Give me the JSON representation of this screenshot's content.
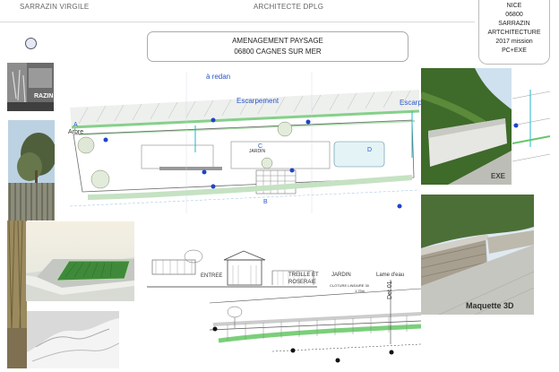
{
  "header": {
    "left": "SARRAZIN VIRGILE",
    "center": "ARCHITECTE DPLG"
  },
  "stamp": {
    "lines": [
      "NICE",
      "06800",
      "SARRAZIN",
      "ARTCHITECTURE",
      "2017 mission",
      "PC+EXE"
    ]
  },
  "title": {
    "line1": "AMENAGEMENT PAYSAGE",
    "line2": "06800 CAGNES SUR MER"
  },
  "plan_labels": {
    "redan": "à redan",
    "escarpement": "Escarpement",
    "escarpement_right": "Escarpement",
    "arbre": "Arbre",
    "jardin": "JARDIN",
    "a_marker": "A",
    "b_marker": "B",
    "c_marker": "C",
    "d_marker": "D"
  },
  "photo_labels": {
    "logo": "RAZIN",
    "exe": "EXE",
    "maquette": "Maquette 3D"
  },
  "section_labels": {
    "entree": "ENTREE",
    "treille": "TREILLE ET",
    "roseraie": "ROSERAIE",
    "jardin": "JARDIN",
    "lame": "Lame d'eau",
    "det": "Det 01",
    "cloture": "CLOTURE LINEAIRE 30",
    "height": "1.75m"
  }
}
